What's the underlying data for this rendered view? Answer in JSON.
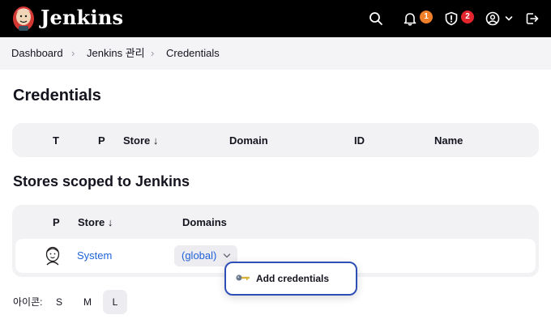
{
  "header": {
    "brand": "Jenkins",
    "notifications_count": "1",
    "security_count": "2",
    "colors": {
      "bar": "#000000",
      "notification_badge": "#f07f29",
      "security_badge": "#e3262d"
    }
  },
  "breadcrumb": [
    "Dashboard",
    "Jenkins 관리",
    "Credentials"
  ],
  "credentials": {
    "title": "Credentials",
    "columns": [
      "T",
      "P",
      "Store",
      "Domain",
      "ID",
      "Name"
    ],
    "sort_glyph": "↓"
  },
  "stores": {
    "title": "Stores scoped to Jenkins",
    "columns": [
      "P",
      "Store",
      "Domains"
    ],
    "sort_glyph": "↓",
    "rows": [
      {
        "store": "System",
        "domain": "(global)"
      }
    ]
  },
  "dropdown": {
    "item": "Add credentials"
  },
  "icon_size": {
    "label": "아이콘:",
    "options": [
      "S",
      "M",
      "L"
    ],
    "selected": "L"
  }
}
